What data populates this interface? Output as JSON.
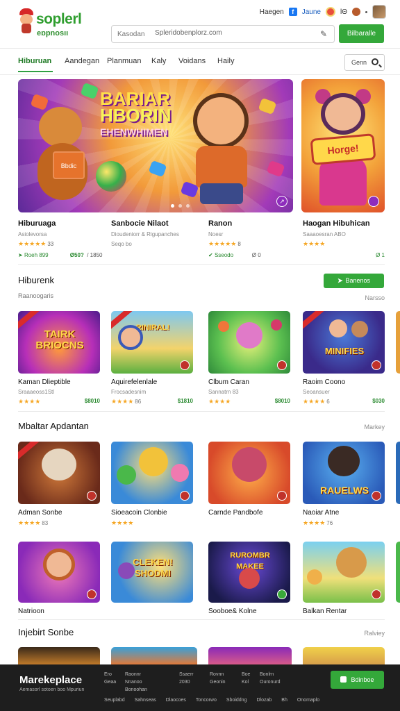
{
  "header": {
    "logo_line1": "soplerl",
    "logo_line2": "eɒpnosıı",
    "top_link_1": "Haegen",
    "facebook_glyph": "f",
    "top_link_2": "Jaune",
    "top_link_3": "lΘ",
    "search_prefix": "Kasodan",
    "search_placeholder": "Spleridobenplorz.com",
    "search_button": "Bilbaralle"
  },
  "tabs": [
    {
      "label": "Hiburuan",
      "active": true
    },
    {
      "label": "Aandegan",
      "active": false
    },
    {
      "label": "Planmuan",
      "active": false
    },
    {
      "label": "Kaly",
      "active": false
    },
    {
      "label": "Voidans",
      "active": false
    },
    {
      "label": "Haily",
      "active": false
    }
  ],
  "tab_search_label": "Genn",
  "hero": {
    "title_l1": "BARIAR",
    "title_l2": "HBORIN",
    "title_l3": "EHENWHIMEN",
    "box_label": "Bbdic",
    "side_sign": "Horge!"
  },
  "featured": [
    {
      "name": "Hiburuaga",
      "sub": "Asiolevorsa",
      "stars": "★★★★★",
      "count": "33",
      "meta1": "Roeh 899",
      "meta2": "Ø50?",
      "meta3": "/ 1850"
    },
    {
      "name": "Sanbocie Nilaot",
      "sub": "Dioudeniorr & Rigupanches",
      "stars": "",
      "count": "Seqo bo",
      "meta1": "",
      "meta2": "",
      "meta3": ""
    },
    {
      "name": "Ranon",
      "sub": "Noesr",
      "stars": "★★★★★",
      "count": "8",
      "meta1": "Sseodo",
      "meta2": "",
      "meta3": "Ø  0"
    },
    {
      "name": "Haogan Hibuhican",
      "sub": "Saaaoesran ABO",
      "stars": "★★★★",
      "count": "",
      "meta1": "",
      "meta2": "",
      "meta3": "Ø 1"
    }
  ],
  "section1": {
    "title": "Hiburenk",
    "subtitle": "Raanoogaris",
    "right": "Narsso",
    "button": "Banenos",
    "cards": [
      {
        "label": "TAIRK BRIOCNS",
        "name": "Kaman Dlieptible",
        "sub": "Sraaaeoss1Stl",
        "stars": "★★★★",
        "count": "",
        "price": "$8010"
      },
      {
        "label": "RINIRAL!",
        "name": "Aquirefelenlale",
        "sub": "Frocsadesnim",
        "stars": "★★★★",
        "count": "86",
        "price": "$1810"
      },
      {
        "label": "",
        "name": "Clbum Caran",
        "sub": "Sannatrn 83",
        "stars": "★★★★",
        "count": "",
        "price": "$8010"
      },
      {
        "label": "MINIFIES",
        "name": "Raoim Coono",
        "sub": "Seoansuer",
        "stars": "★★★★",
        "count": "6",
        "price": "$030"
      }
    ]
  },
  "section2": {
    "title": "Mbaltar Apdantan",
    "right": "Markey",
    "cards": [
      {
        "label": "",
        "name": "Adman Sonbe",
        "stars": "★★★★",
        "count": "83"
      },
      {
        "label": "",
        "name": "Sioeacoin Clonbie",
        "stars": "★★★★",
        "count": ""
      },
      {
        "label": "",
        "name": "Carnde Pandbofe",
        "stars": "",
        "count": ""
      },
      {
        "label": "RAUELWS",
        "name": "Naoiar Atne",
        "stars": "★★★★",
        "count": "76"
      },
      {
        "label": "",
        "name": "Natrioon",
        "stars": "",
        "count": ""
      },
      {
        "label": "CLEKEN! SHODMI",
        "name": "",
        "stars": "",
        "count": ""
      },
      {
        "label": "RUROMBR MAKEE",
        "name": "Sooboe& Kolne",
        "stars": "",
        "count": ""
      },
      {
        "label": "",
        "name": "Balkan Rentar",
        "stars": "",
        "count": ""
      }
    ]
  },
  "section3": {
    "title": "Injebirt Sonbe",
    "right": "Ralviey"
  },
  "footer": {
    "brand": "Marekeplace",
    "tagline": "Aemasorl sotoen boo Mpuriun",
    "col1": [
      "Ero",
      "Geaa"
    ],
    "col2": [
      "Raonnr",
      "Nnanoo",
      "Bonoohan"
    ],
    "col3": [
      "Ssaerr",
      "2030"
    ],
    "col4": [
      "Rovnn",
      "Geonin"
    ],
    "col5": [
      "Boe",
      "Kol"
    ],
    "col6": [
      "Bonlrn",
      "Ouronurd"
    ],
    "links": [
      "Seuplabd",
      "Sahnseas",
      "Dlaocoes",
      "Toncorwo",
      "Sboiddng",
      "Dlozab",
      "Bh",
      "Onomaplo"
    ],
    "button": "Bdinboe"
  },
  "colors": {
    "accent": "#34a83a",
    "star": "#f5a623",
    "footer_bg": "#1e1e1e"
  }
}
